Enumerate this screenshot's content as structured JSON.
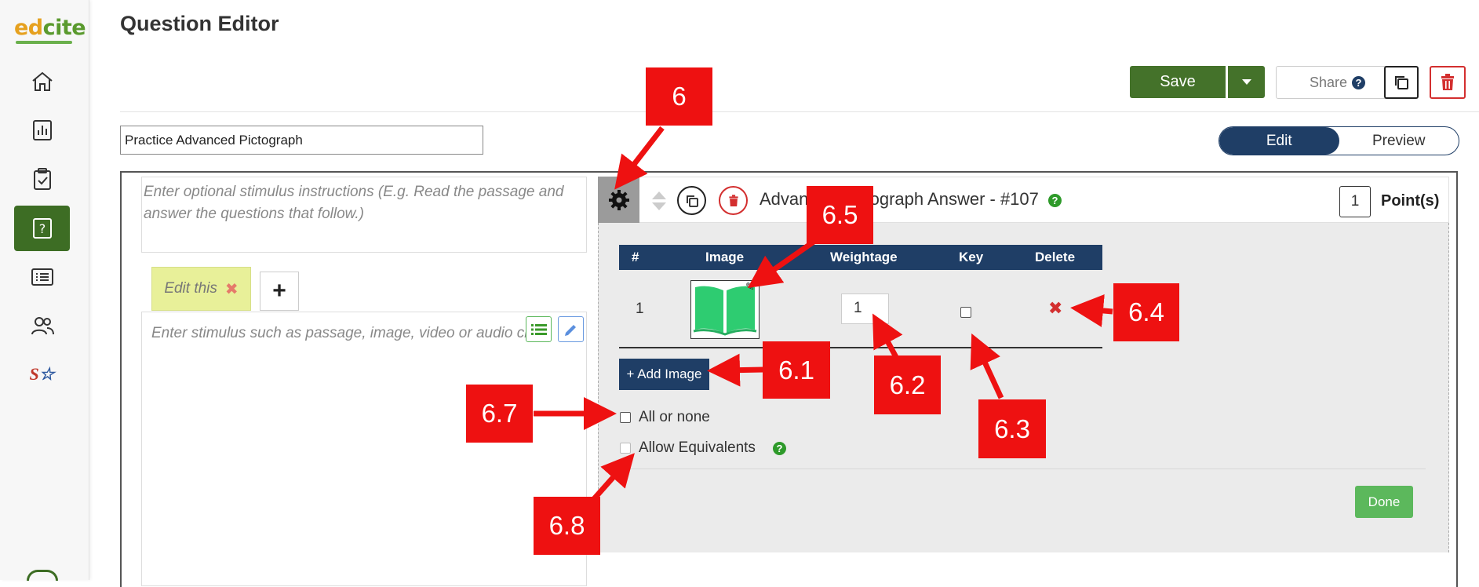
{
  "app": {
    "logo_ed": "ed",
    "logo_cite": "cite"
  },
  "sidebar": {
    "items": [
      {
        "name": "home",
        "icon": "home-icon",
        "active": false
      },
      {
        "name": "reports",
        "icon": "bar-chart-icon",
        "active": false
      },
      {
        "name": "assignments",
        "icon": "clipboard-check-icon",
        "active": false
      },
      {
        "name": "questions",
        "icon": "question-box-icon",
        "active": true
      },
      {
        "name": "lists",
        "icon": "list-icon",
        "active": false
      },
      {
        "name": "users",
        "icon": "users-icon",
        "active": false
      },
      {
        "name": "standards",
        "icon": "sv-star-icon",
        "active": false,
        "label": "S"
      }
    ]
  },
  "header": {
    "title": "Question Editor",
    "save_label": "Save",
    "share_label": "Share",
    "share_help": "?",
    "question_title": "Practice Advanced Pictograph",
    "mode_edit": "Edit",
    "mode_preview": "Preview"
  },
  "stimulus": {
    "instructions_placeholder": "Enter optional stimulus instructions (E.g. Read the passage and answer the questions that follow.)",
    "tab_label": "Edit this",
    "tab_close": "✖",
    "tab_add": "+",
    "body_placeholder": "Enter stimulus such as passage, image, video or audio clip"
  },
  "editor": {
    "title": "Advanced Pictograph Answer - #107",
    "help": "?",
    "points_value": "1",
    "points_label": "Point(s)",
    "table": {
      "headers": {
        "num": "#",
        "image": "Image",
        "weightage": "Weightage",
        "key": "Key",
        "delete": "Delete"
      },
      "rows": [
        {
          "num": "1",
          "image": "open-book-icon",
          "weightage": "1",
          "key": false
        }
      ]
    },
    "add_image_label": "+ Add Image",
    "all_or_none_label": "All or none",
    "allow_equivalents_label": "Allow Equivalents",
    "allow_help": "?",
    "done_label": "Done"
  },
  "callouts": {
    "c6": "6",
    "c65": "6.5",
    "c64": "6.4",
    "c61": "6.1",
    "c62": "6.2",
    "c63": "6.3",
    "c67": "6.7",
    "c68": "6.8"
  },
  "colors": {
    "brand_green": "#44722a",
    "navy": "#1f3e66",
    "callout_red": "#e11111",
    "done_green": "#5cb85c"
  }
}
